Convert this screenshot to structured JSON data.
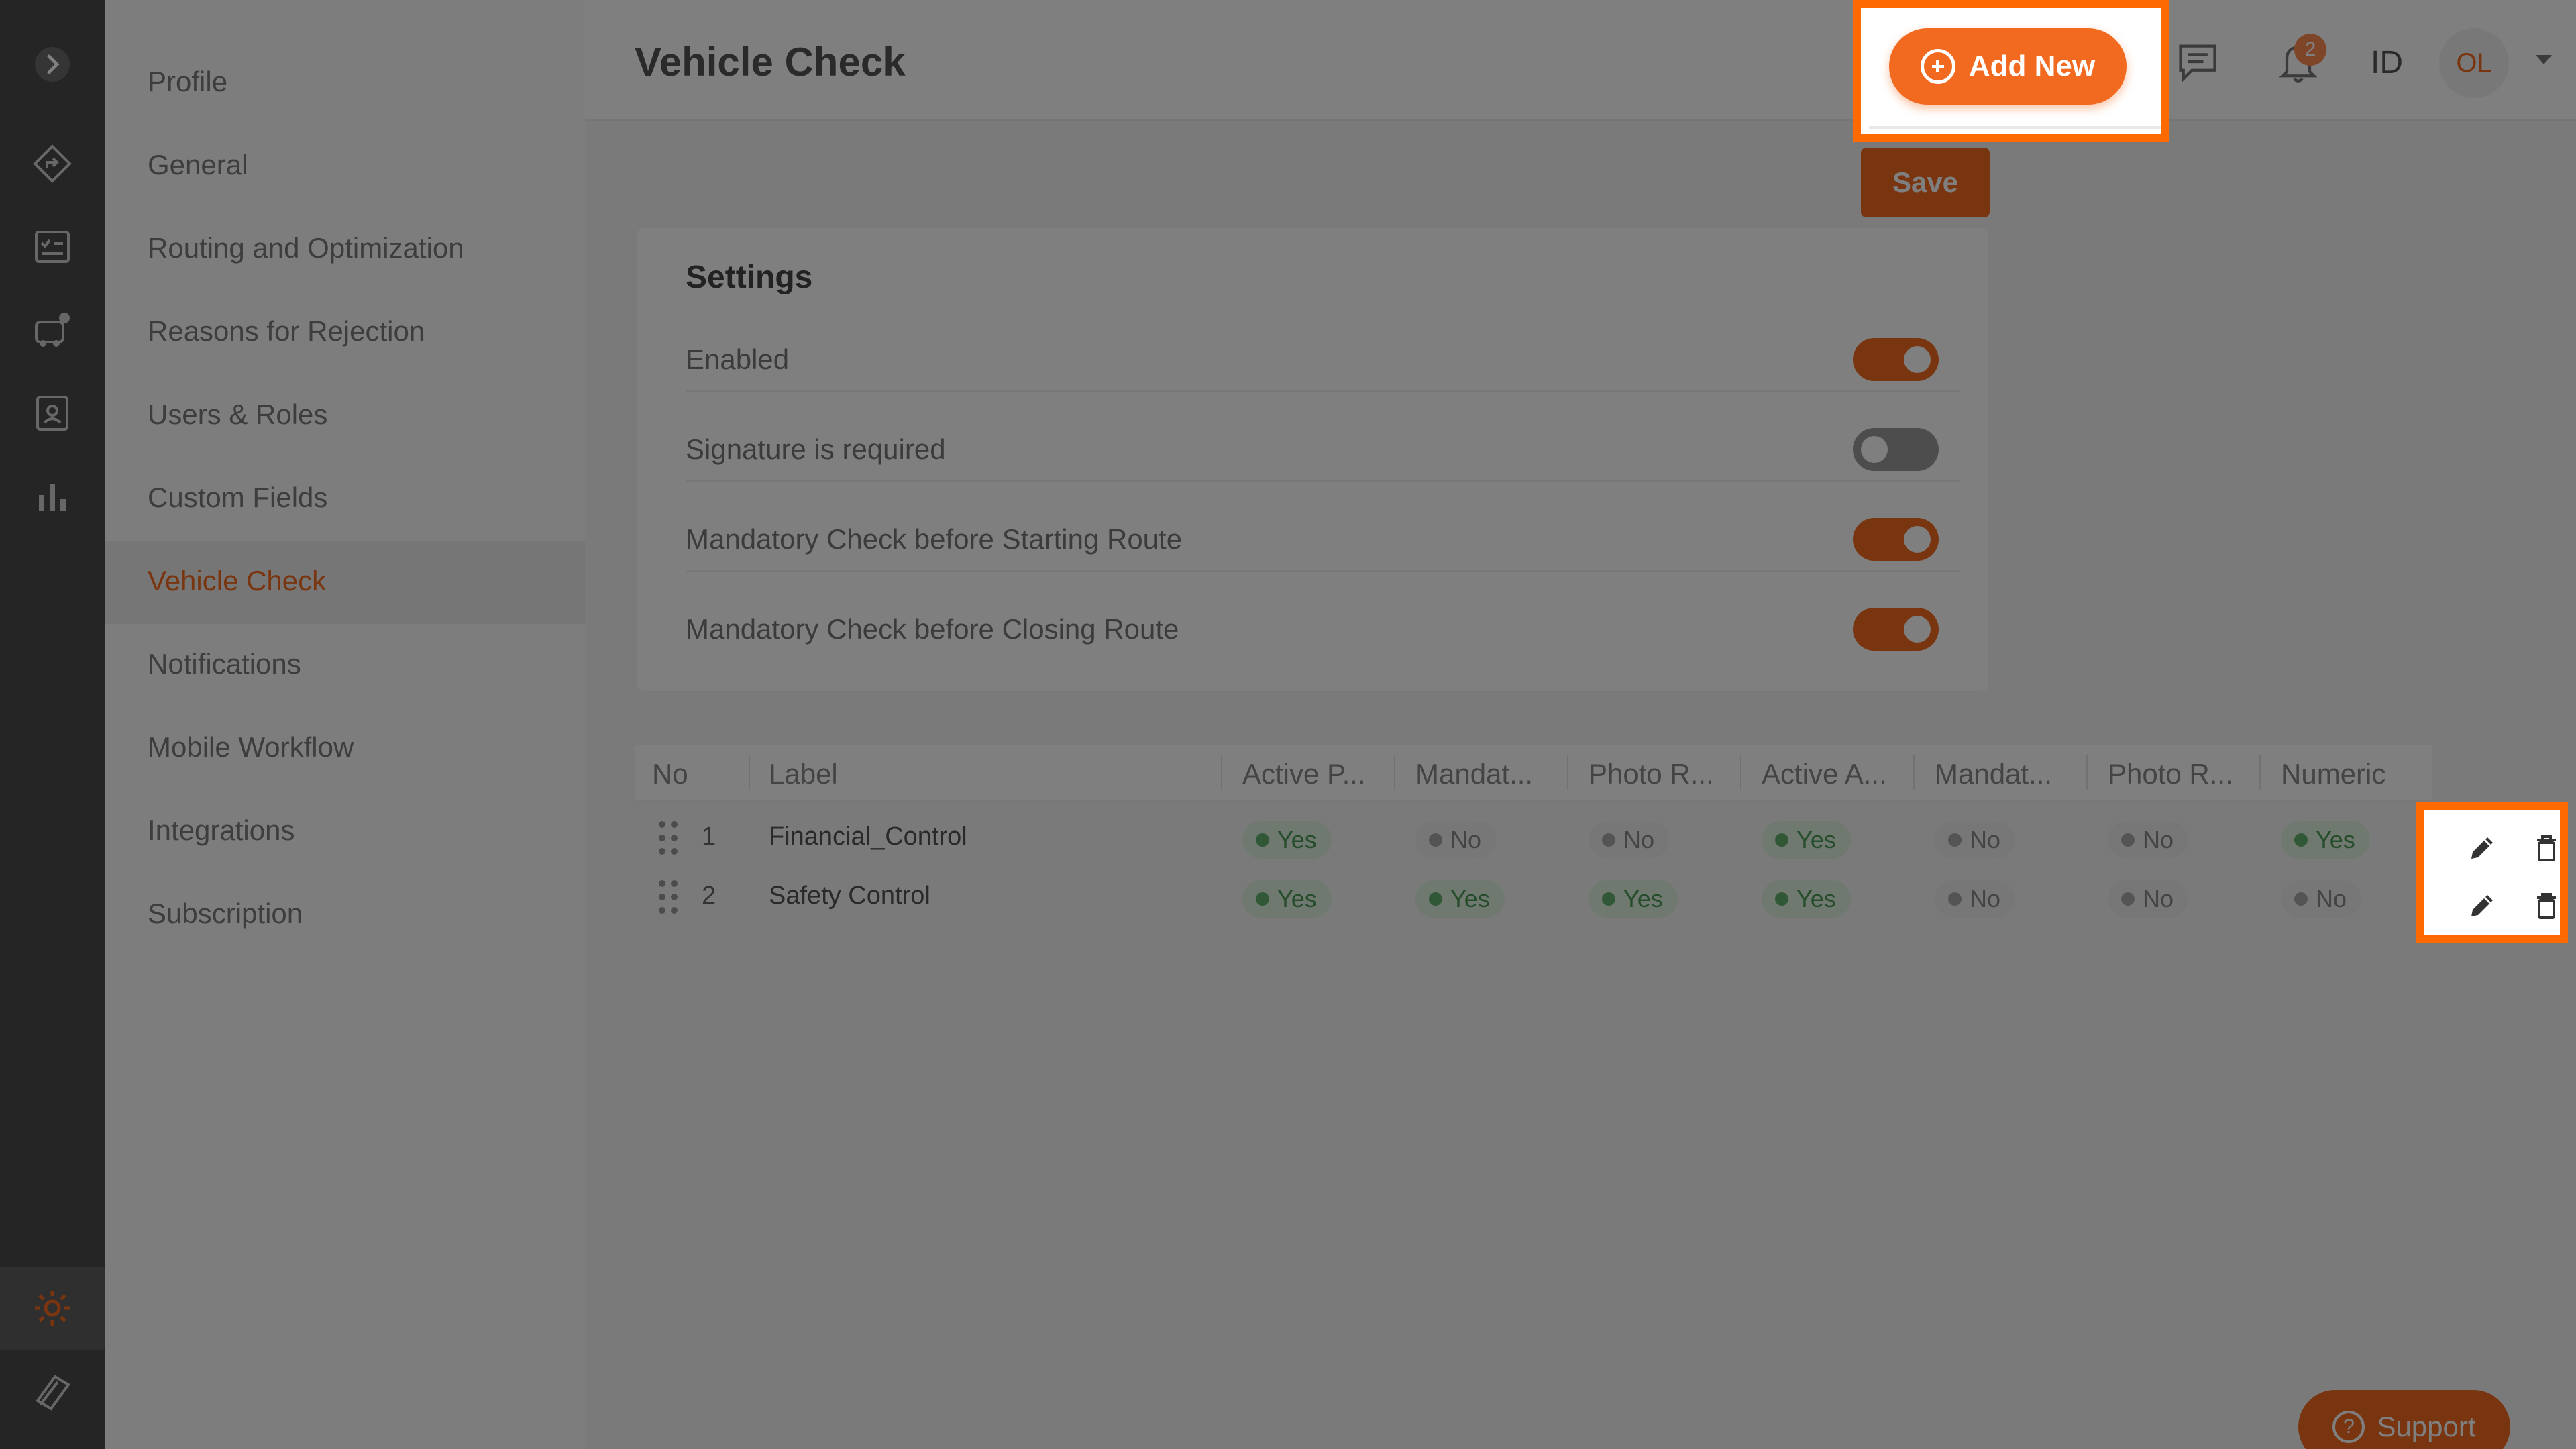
{
  "header": {
    "title": "Vehicle Check",
    "add_new_label": "Add New",
    "language": "ID",
    "avatar_initials": "OL",
    "notification_count": "2"
  },
  "sidebar": {
    "items": [
      {
        "label": "Profile"
      },
      {
        "label": "General"
      },
      {
        "label": "Routing and Optimization"
      },
      {
        "label": "Reasons for Rejection"
      },
      {
        "label": "Users & Roles"
      },
      {
        "label": "Custom Fields"
      },
      {
        "label": "Vehicle Check",
        "active": true
      },
      {
        "label": "Notifications"
      },
      {
        "label": "Mobile Workflow"
      },
      {
        "label": "Integrations"
      },
      {
        "label": "Subscription"
      }
    ]
  },
  "rail_icons": [
    "chevron-right-icon",
    "route-diamond-icon",
    "checklist-icon",
    "vehicle-icon",
    "contacts-icon",
    "bar-chart-icon",
    "gear-icon",
    "book-icon"
  ],
  "actions": {
    "save_label": "Save"
  },
  "settings": {
    "title": "Settings",
    "rows": [
      {
        "label": "Enabled",
        "on": true
      },
      {
        "label": "Signature is required",
        "on": false
      },
      {
        "label": "Mandatory Check before Starting Route",
        "on": true
      },
      {
        "label": "Mandatory Check before Closing Route",
        "on": true
      }
    ]
  },
  "table": {
    "headers": [
      "No",
      "Label",
      "Active P...",
      "Mandat...",
      "Photo R...",
      "Active A...",
      "Mandat...",
      "Photo R...",
      "Numeric"
    ],
    "rows": [
      {
        "no": "1",
        "label": "Financial_Control",
        "values": [
          "Yes",
          "No",
          "No",
          "Yes",
          "No",
          "No",
          "Yes"
        ]
      },
      {
        "no": "2",
        "label": "Safety Control",
        "values": [
          "Yes",
          "Yes",
          "Yes",
          "Yes",
          "No",
          "No",
          "No"
        ]
      }
    ]
  },
  "support": {
    "label": "Support"
  },
  "colors": {
    "accent": "#f26a1f",
    "highlight": "#ff6a00",
    "yes": "#62b06c",
    "no": "#a8a8a8"
  }
}
